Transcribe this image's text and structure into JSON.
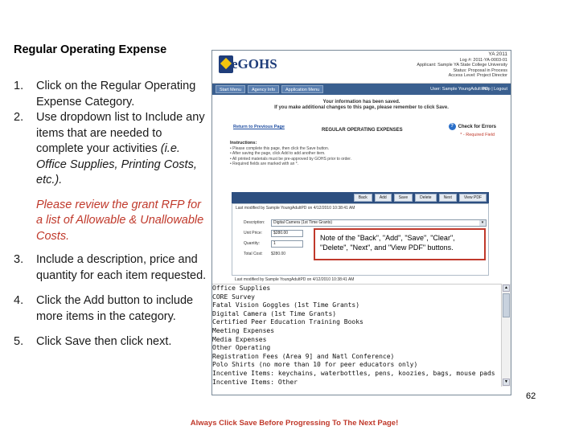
{
  "slide": {
    "title": "Regular Operating Expense",
    "page_number": "62",
    "footer": "Always Click Save Before Progressing To The Next Page!"
  },
  "steps": [
    {
      "num": "1.",
      "text": "Click on the Regular Operating Expense Category."
    },
    {
      "num": "2.",
      "text_main": "Use dropdown list to Include any items that are needed to complete  your activities ",
      "text_italic": "(i.e. Office Supplies, Printing Costs, etc.)."
    },
    {
      "num": "3.",
      "text": "Include a description, price and quantity for each item requested."
    },
    {
      "num": "4.",
      "text": "Click the Add button to include more items in the category."
    },
    {
      "num": "5.",
      "text": "Click Save then click next."
    }
  ],
  "note": "Please review the grant RFP for a list of Allowable & Unallowable Costs.",
  "app": {
    "logo_text": "eGOHS",
    "header_info": [
      "YA 2011",
      "Log #: 2011-YA-0003-01",
      "Applicant: Sample YA State College University",
      "Status: Proposal in Process",
      "Access Level: Project Director"
    ],
    "nav": [
      "Start Menu",
      "Agency Info",
      "Application Menu"
    ],
    "user": "User: Sample YoungAdult PD",
    "help": "Help | Logout",
    "saved_line1": "Your information has been saved.",
    "saved_line2": "If you make additional changes to this page, please remember to click Save.",
    "back_link": "Return to Previous Page",
    "section_title": "REGULAR OPERATING EXPENSES",
    "check_errors": "Check for Errors",
    "required_field": "* - Required Field",
    "instructions_title": "Instructions:",
    "instructions": [
      "Please complete this page, then click the Save button.",
      "After saving the page, click Add to add another item.",
      "All printed materials must be pre-approved by GOHS prior to order.",
      "Required fields are marked with an *."
    ],
    "buttons": [
      "Back",
      "Add",
      "Save",
      "Delete",
      "Next",
      "View PDF"
    ],
    "last_modified": "Last modified by Sample YoungAdultPD on 4/12/2010 10:38:41 AM",
    "description_label": "Description:",
    "description_value": "Digital Camera (1st Time Grants)",
    "unit_price_label": "Unit Price:",
    "unit_price_value": "$280.00",
    "quantity_label": "Quantity:",
    "quantity_value": "1",
    "total_cost_label": "Total Cost:",
    "total_cost_value": "$280.00",
    "last_modified_2": "Last modified by Sample YoungAdultPD on 4/12/2010 10:38:41 AM",
    "dropdown_items": [
      "Office Supplies",
      "CORE Survey",
      "Fatal Vision Goggles (1st Time Grants)",
      "Digital Camera (1st Time Grants)",
      "Certified Peer Education Training Books",
      "Meeting Expenses",
      "Media Expenses",
      "Other Operating",
      "Registration Fees (Area 9] and Natl Conference)",
      "Polo Shirts (no more than 10 for peer educators only)",
      "Incentive Items: keychains, waterbottles, pens, koozies, bags, mouse pads",
      "Incentive Items: Other"
    ]
  },
  "callout": "Note of the \"Back\", \"Add\", \"Save\", \"Clear\", \"Delete\", \"Next\", and \"View PDF\" buttons.",
  "colors": {
    "accent_red": "#c0392b",
    "nav_blue": "#3a5f8f",
    "logo_blue": "#1f3d7a"
  }
}
